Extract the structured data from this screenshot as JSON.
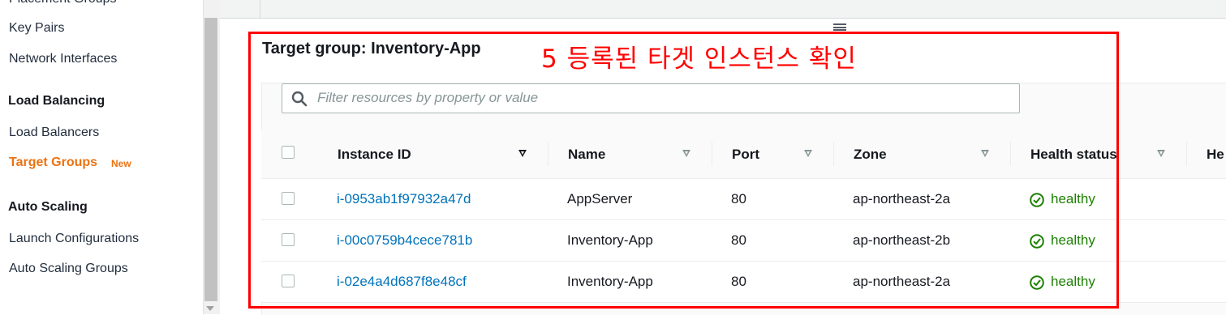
{
  "sidebar": {
    "partial_item": "Placement Groups",
    "network_items": [
      "Key Pairs",
      "Network Interfaces"
    ],
    "load_balancing": {
      "heading": "Load Balancing",
      "items": [
        "Load Balancers",
        "Target Groups"
      ],
      "active_item": "Target Groups",
      "badge": "New"
    },
    "auto_scaling": {
      "heading": "Auto Scaling",
      "items": [
        "Launch Configurations",
        "Auto Scaling Groups"
      ]
    }
  },
  "panel": {
    "title": "Target group: Inventory-App",
    "annotation": "5 등록된 타겟 인스턴스 확인"
  },
  "search": {
    "placeholder": "Filter resources by property or value",
    "icon": "search-icon"
  },
  "table": {
    "columns": [
      "Instance ID",
      "Name",
      "Port",
      "Zone",
      "Health status",
      "He"
    ],
    "rows": [
      {
        "instance_id": "i-0953ab1f97932a47d",
        "name": "AppServer",
        "port": "80",
        "zone": "ap-northeast-2a",
        "health": "healthy"
      },
      {
        "instance_id": "i-00c0759b4cece781b",
        "name": "Inventory-App",
        "port": "80",
        "zone": "ap-northeast-2b",
        "health": "healthy"
      },
      {
        "instance_id": "i-02e4a4d687f8e48cf",
        "name": "Inventory-App",
        "port": "80",
        "zone": "ap-northeast-2a",
        "health": "healthy"
      }
    ]
  },
  "colors": {
    "accent": "#ec7211",
    "link": "#0073bb",
    "healthy": "#1d8102",
    "annotation": "#ff0000"
  }
}
